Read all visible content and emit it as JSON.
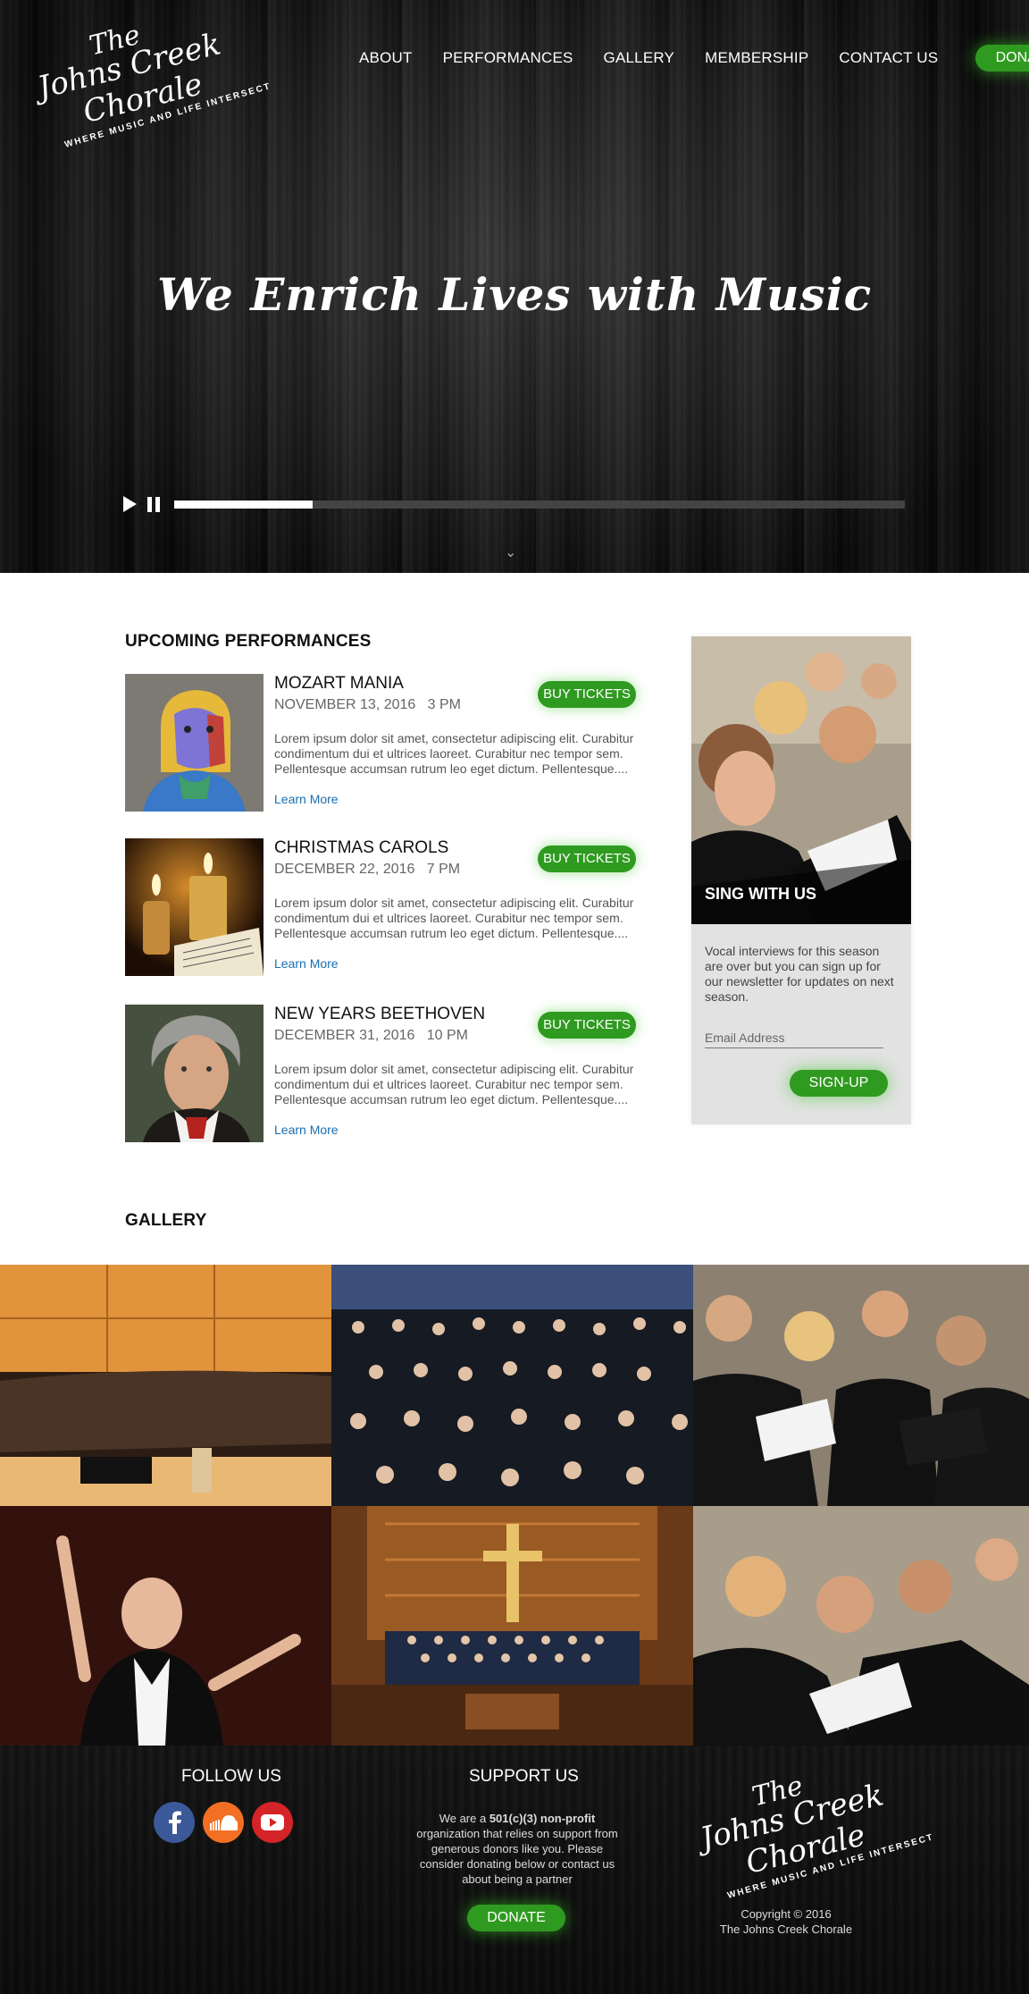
{
  "brand": {
    "line1": "The",
    "line2": "Johns Creek",
    "line3": "Chorale",
    "tagline": "WHERE MUSIC AND LIFE INTERSECT"
  },
  "nav": {
    "items": [
      "ABOUT",
      "PERFORMANCES",
      "GALLERY",
      "MEMBERSHIP",
      "CONTACT US"
    ],
    "donate_label": "DONATE"
  },
  "hero": {
    "title": "We Enrich Lives with Music",
    "player_progress": 0.19,
    "scroll_glyph": "⌄"
  },
  "performances": {
    "heading": "UPCOMING PERFORMANCES",
    "buy_label": "BUY TICKETS",
    "more_label": "Learn More",
    "events": [
      {
        "name": "MOZART MANIA",
        "date": "NOVEMBER 13, 2016",
        "time": "3 PM",
        "desc": "Lorem ipsum dolor sit amet, consectetur adipiscing elit. Curabitur condimentum dui et ultrices laoreet. Curabitur nec tempor sem. Pellentesque accumsan rutrum leo eget dictum. Pellentesque...."
      },
      {
        "name": "CHRISTMAS CAROLS",
        "date": "DECEMBER 22, 2016",
        "time": "7 PM",
        "desc": "Lorem ipsum dolor sit amet, consectetur adipiscing elit. Curabitur condimentum dui et ultrices laoreet. Curabitur nec tempor sem. Pellentesque accumsan rutrum leo eget dictum. Pellentesque...."
      },
      {
        "name": "NEW YEARS BEETHOVEN",
        "date": "DECEMBER 31, 2016",
        "time": "10 PM",
        "desc": "Lorem ipsum dolor sit amet, consectetur adipiscing elit. Curabitur condimentum dui et ultrices laoreet. Curabitur nec tempor sem. Pellentesque accumsan rutrum leo eget dictum. Pellentesque...."
      }
    ]
  },
  "signup": {
    "title": "SING WITH US",
    "text": "Vocal interviews for this season are over but you can sign up for our newsletter for updates on next season.",
    "email_placeholder": "Email Address",
    "button_label": "SIGN-UP"
  },
  "gallery": {
    "heading": "GALLERY"
  },
  "footer": {
    "follow_heading": "FOLLOW US",
    "support_heading": "SUPPORT US",
    "support_pre": "We are a ",
    "support_bold": "501(c)(3) non-profit",
    "support_post": " organization that relies on support from generous donors like you. Please consider donating below or contact us about being a partner",
    "donate_label": "DONATE",
    "copyright_line1": "Copyright © 2016",
    "copyright_line2": "The Johns Creek Chorale"
  },
  "colors": {
    "accent_green": "#2f9a20",
    "link_blue": "#1a6fb0",
    "facebook": "#3b5998",
    "soundcloud": "#f26f23",
    "youtube": "#d42428"
  }
}
